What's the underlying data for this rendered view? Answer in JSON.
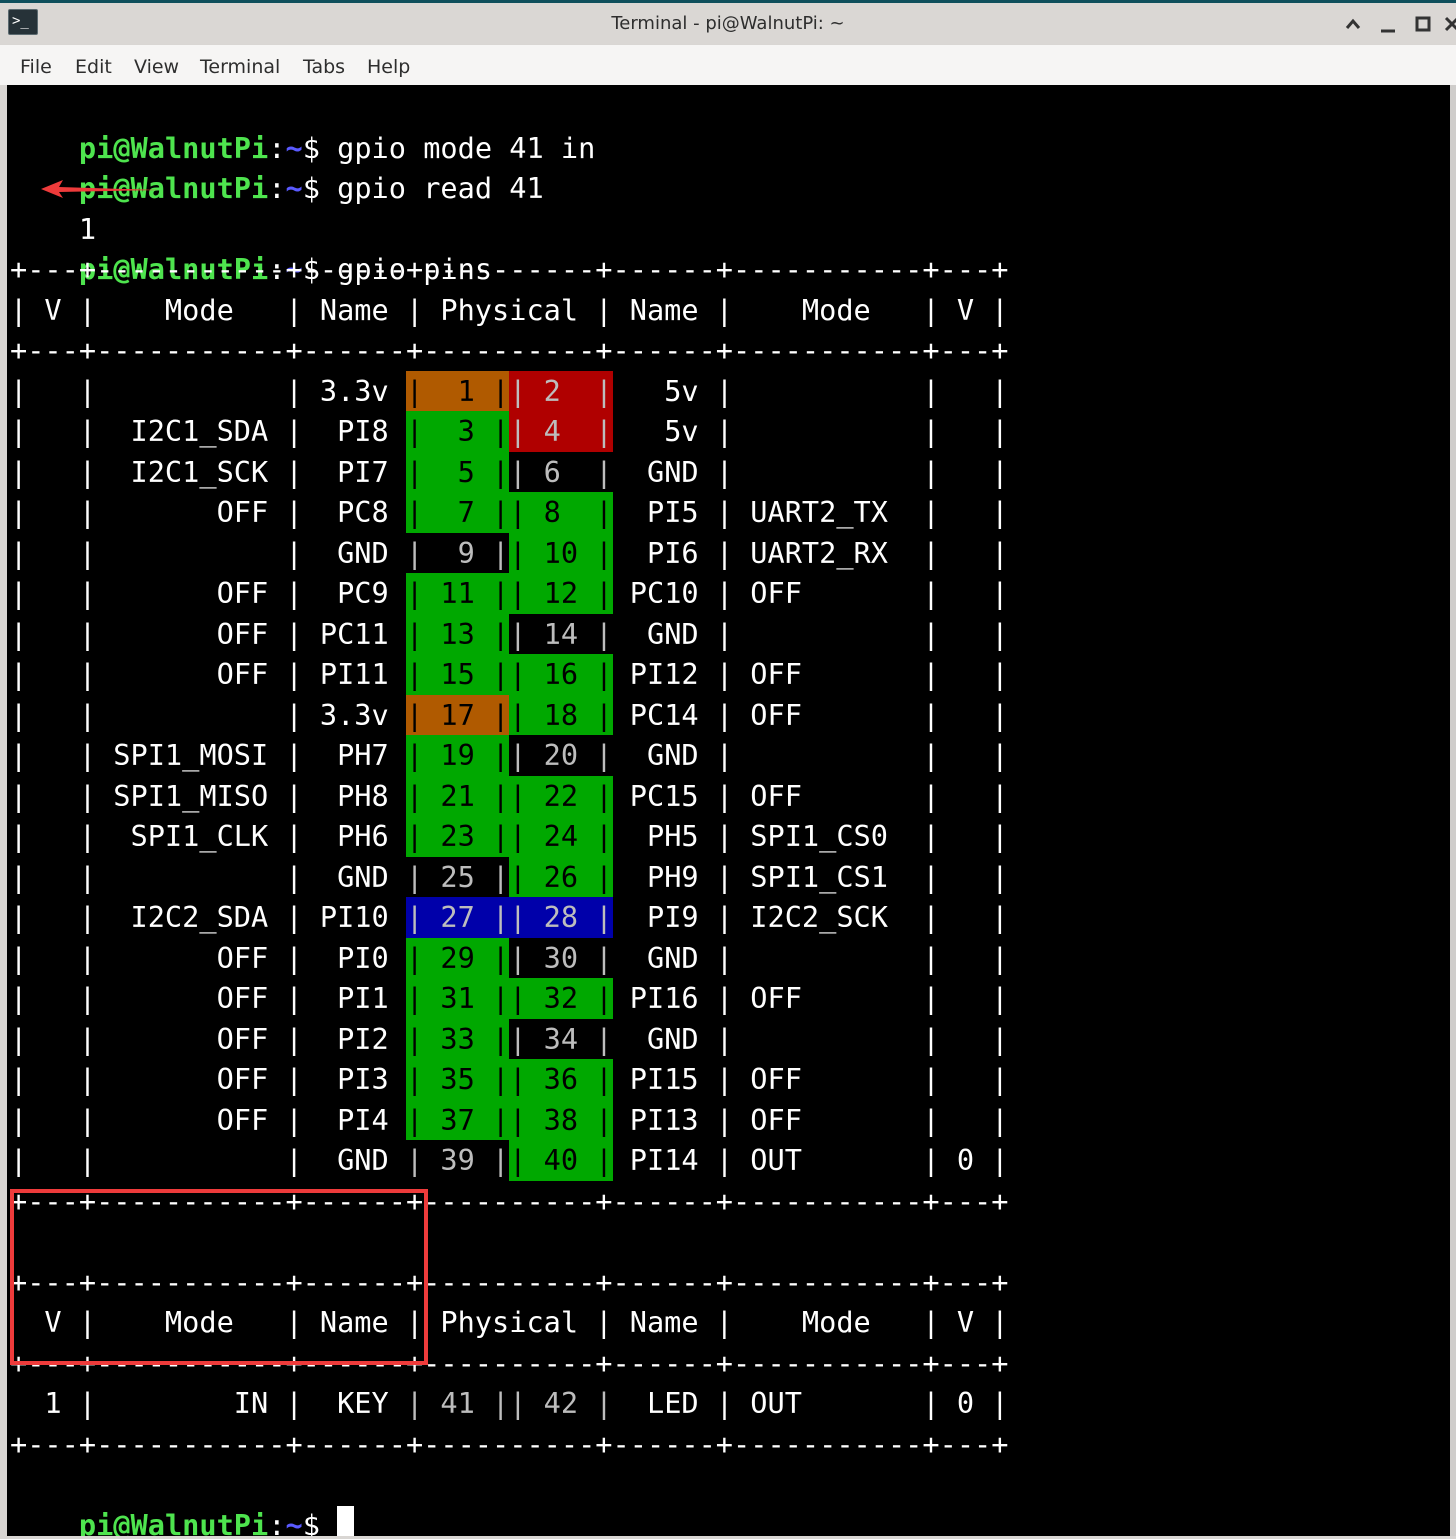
{
  "window": {
    "title": "Terminal - pi@WalnutPi: ~",
    "app_icon": "terminal-icon",
    "controls": [
      {
        "name": "shade-button",
        "glyph": "⌃"
      },
      {
        "name": "minimize-button",
        "glyph": "_"
      },
      {
        "name": "maximize-button",
        "glyph": "☐"
      },
      {
        "name": "close-button",
        "glyph": "✕"
      }
    ]
  },
  "menubar": {
    "items": [
      "File",
      "Edit",
      "View",
      "Terminal",
      "Tabs",
      "Help"
    ]
  },
  "prompt": {
    "user_host": "pi@WalnutPi",
    "colon": ":",
    "path": "~",
    "dollar": "$ "
  },
  "session": {
    "commands": [
      "gpio mode 41 in",
      "gpio read 41",
      "gpio pins"
    ],
    "read_output": "1",
    "arrow_annotation": "red-arrow-pointing-to-output"
  },
  "colors": {
    "prompt_green": "#4ee44e",
    "path_blue": "#5a5aff",
    "pin_power33": "#b05a00",
    "pin_power5": "#b00000",
    "pin_gpio": "#00a800",
    "pin_i2c_eeprom": "#0000aa",
    "annotation_red": "#ee3b3b"
  },
  "table": {
    "border": "+---+-----------+------+----------+------+-----------+---+",
    "header": "| V |    Mode   | Name | Physical | Name |    Mode   | V |",
    "header_cols": {
      "v_left": "V",
      "mode_left": "Mode",
      "name_left": "Name",
      "physical": "Physical",
      "name_right": "Name",
      "mode_right": "Mode",
      "v_right": "V"
    },
    "rows": [
      {
        "v_l": "",
        "mode_l": "",
        "name_l": "3.3v",
        "pin_l": "1",
        "pin_r": "2",
        "name_r": "5v",
        "mode_r": "",
        "v_r": "",
        "color_l": "power33",
        "color_r": "power5"
      },
      {
        "v_l": "",
        "mode_l": "I2C1_SDA",
        "name_l": "PI8",
        "pin_l": "3",
        "pin_r": "4",
        "name_r": "5v",
        "mode_r": "",
        "v_r": "",
        "color_l": "gpio",
        "color_r": "power5"
      },
      {
        "v_l": "",
        "mode_l": "I2C1_SCK",
        "name_l": "PI7",
        "pin_l": "5",
        "pin_r": "6",
        "name_r": "GND",
        "mode_r": "",
        "v_r": "",
        "color_l": "gpio",
        "color_r": "none"
      },
      {
        "v_l": "",
        "mode_l": "OFF",
        "name_l": "PC8",
        "pin_l": "7",
        "pin_r": "8",
        "name_r": "PI5",
        "mode_r": "UART2_TX",
        "v_r": "",
        "color_l": "gpio",
        "color_r": "gpio"
      },
      {
        "v_l": "",
        "mode_l": "",
        "name_l": "GND",
        "pin_l": "9",
        "pin_r": "10",
        "name_r": "PI6",
        "mode_r": "UART2_RX",
        "v_r": "",
        "color_l": "none",
        "color_r": "gpio"
      },
      {
        "v_l": "",
        "mode_l": "OFF",
        "name_l": "PC9",
        "pin_l": "11",
        "pin_r": "12",
        "name_r": "PC10",
        "mode_r": "OFF",
        "v_r": "",
        "color_l": "gpio",
        "color_r": "gpio"
      },
      {
        "v_l": "",
        "mode_l": "OFF",
        "name_l": "PC11",
        "pin_l": "13",
        "pin_r": "14",
        "name_r": "GND",
        "mode_r": "",
        "v_r": "",
        "color_l": "gpio",
        "color_r": "none"
      },
      {
        "v_l": "",
        "mode_l": "OFF",
        "name_l": "PI11",
        "pin_l": "15",
        "pin_r": "16",
        "name_r": "PI12",
        "mode_r": "OFF",
        "v_r": "",
        "color_l": "gpio",
        "color_r": "gpio"
      },
      {
        "v_l": "",
        "mode_l": "",
        "name_l": "3.3v",
        "pin_l": "17",
        "pin_r": "18",
        "name_r": "PC14",
        "mode_r": "OFF",
        "v_r": "",
        "color_l": "power33",
        "color_r": "gpio"
      },
      {
        "v_l": "",
        "mode_l": "SPI1_MOSI",
        "name_l": "PH7",
        "pin_l": "19",
        "pin_r": "20",
        "name_r": "GND",
        "mode_r": "",
        "v_r": "",
        "color_l": "gpio",
        "color_r": "none"
      },
      {
        "v_l": "",
        "mode_l": "SPI1_MISO",
        "name_l": "PH8",
        "pin_l": "21",
        "pin_r": "22",
        "name_r": "PC15",
        "mode_r": "OFF",
        "v_r": "",
        "color_l": "gpio",
        "color_r": "gpio"
      },
      {
        "v_l": "",
        "mode_l": "SPI1_CLK",
        "name_l": "PH6",
        "pin_l": "23",
        "pin_r": "24",
        "name_r": "PH5",
        "mode_r": "SPI1_CS0",
        "v_r": "",
        "color_l": "gpio",
        "color_r": "gpio"
      },
      {
        "v_l": "",
        "mode_l": "",
        "name_l": "GND",
        "pin_l": "25",
        "pin_r": "26",
        "name_r": "PH9",
        "mode_r": "SPI1_CS1",
        "v_r": "",
        "color_l": "none",
        "color_r": "gpio"
      },
      {
        "v_l": "",
        "mode_l": "I2C2_SDA",
        "name_l": "PI10",
        "pin_l": "27",
        "pin_r": "28",
        "name_r": "PI9",
        "mode_r": "I2C2_SCK",
        "v_r": "",
        "color_l": "i2c_eeprom",
        "color_r": "i2c_eeprom"
      },
      {
        "v_l": "",
        "mode_l": "OFF",
        "name_l": "PI0",
        "pin_l": "29",
        "pin_r": "30",
        "name_r": "GND",
        "mode_r": "",
        "v_r": "",
        "color_l": "gpio",
        "color_r": "none"
      },
      {
        "v_l": "",
        "mode_l": "OFF",
        "name_l": "PI1",
        "pin_l": "31",
        "pin_r": "32",
        "name_r": "PI16",
        "mode_r": "OFF",
        "v_r": "",
        "color_l": "gpio",
        "color_r": "gpio"
      },
      {
        "v_l": "",
        "mode_l": "OFF",
        "name_l": "PI2",
        "pin_l": "33",
        "pin_r": "34",
        "name_r": "GND",
        "mode_r": "",
        "v_r": "",
        "color_l": "gpio",
        "color_r": "none"
      },
      {
        "v_l": "",
        "mode_l": "OFF",
        "name_l": "PI3",
        "pin_l": "35",
        "pin_r": "36",
        "name_r": "PI15",
        "mode_r": "OFF",
        "v_r": "",
        "color_l": "gpio",
        "color_r": "gpio"
      },
      {
        "v_l": "",
        "mode_l": "OFF",
        "name_l": "PI4",
        "pin_l": "37",
        "pin_r": "38",
        "name_r": "PI13",
        "mode_r": "OFF",
        "v_r": "",
        "color_l": "gpio",
        "color_r": "gpio"
      },
      {
        "v_l": "",
        "mode_l": "",
        "name_l": "GND",
        "pin_l": "39",
        "pin_r": "40",
        "name_r": "PI14",
        "mode_r": "OUT",
        "v_r": "0",
        "color_l": "none",
        "color_r": "gpio"
      }
    ]
  },
  "onboard_table": {
    "rows": [
      {
        "v_l": "1",
        "mode_l": "IN",
        "name_l": "KEY",
        "pin_l": "41",
        "pin_r": "42",
        "name_r": "LED",
        "mode_r": "OUT",
        "v_r": "0"
      }
    ],
    "highlight_annotation": "red-box-around-left-columns"
  }
}
